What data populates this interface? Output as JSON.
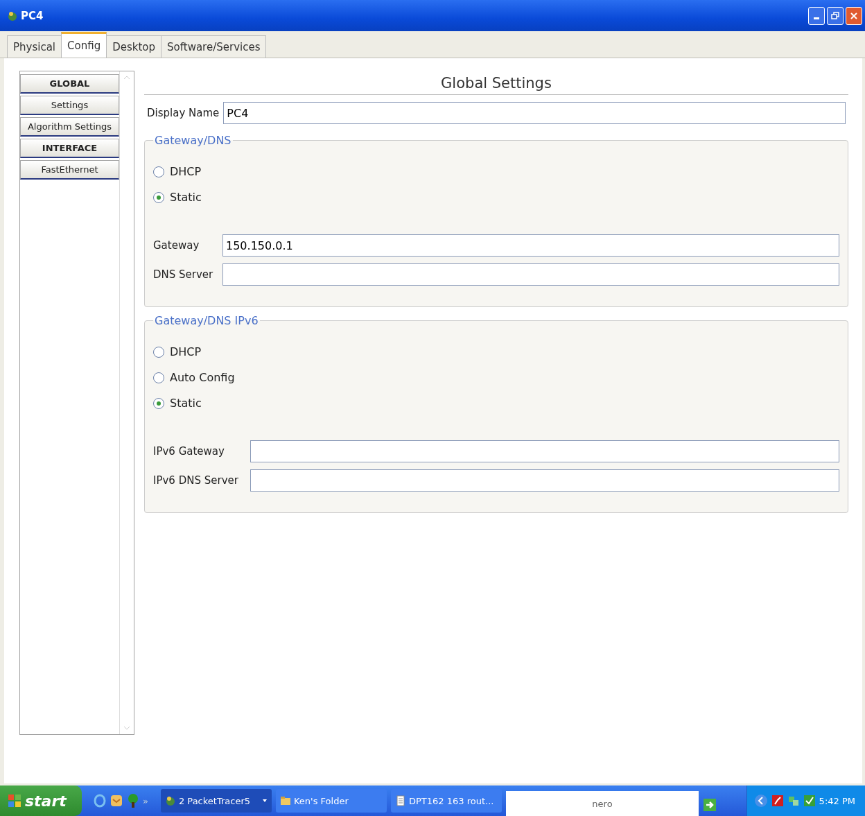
{
  "window": {
    "title": "PC4"
  },
  "tabs": [
    {
      "label": "Physical",
      "selected": false
    },
    {
      "label": "Config",
      "selected": true
    },
    {
      "label": "Desktop",
      "selected": false
    },
    {
      "label": "Software/Services",
      "selected": false
    }
  ],
  "sidebar": {
    "items": [
      {
        "label": "GLOBAL",
        "kind": "header"
      },
      {
        "label": "Settings",
        "kind": "item"
      },
      {
        "label": "Algorithm Settings",
        "kind": "item"
      },
      {
        "label": "INTERFACE",
        "kind": "header"
      },
      {
        "label": "FastEthernet",
        "kind": "item"
      }
    ]
  },
  "panel": {
    "title": "Global Settings",
    "display_name": {
      "label": "Display Name",
      "value": "PC4"
    },
    "groups": [
      {
        "title": "Gateway/DNS",
        "options": [
          {
            "label": "DHCP",
            "selected": false
          },
          {
            "label": "Static",
            "selected": true
          }
        ],
        "fields": [
          {
            "label": "Gateway",
            "value": "150.150.0.1"
          },
          {
            "label": "DNS Server"
          }
        ]
      },
      {
        "title": "Gateway/DNS IPv6",
        "options": [
          {
            "label": "DHCP",
            "selected": false
          },
          {
            "label": "Auto Config",
            "selected": false
          },
          {
            "label": "Static",
            "selected": true
          }
        ],
        "fields": [
          {
            "label": "IPv6 Gateway"
          },
          {
            "label": "IPv6 DNS Server"
          }
        ]
      }
    ]
  },
  "taskbar": {
    "start": "start",
    "more": "»",
    "tasks": [
      {
        "label": "2 PacketTracer5",
        "kind": "group",
        "selected": true
      },
      {
        "label": "Ken's Folder",
        "kind": "folder",
        "selected": false
      },
      {
        "label": "DPT162 163 rout...",
        "kind": "document",
        "selected": false
      }
    ],
    "search_logo": "nero",
    "clock": "5:42 PM"
  }
}
